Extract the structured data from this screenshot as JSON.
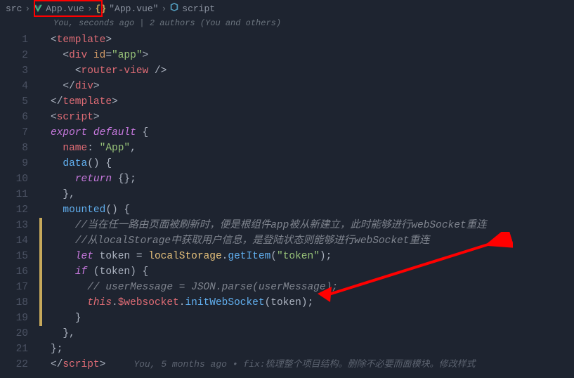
{
  "breadcrumb": {
    "src": "src",
    "file": "App.vue",
    "symbol_text": "\"App.vue\"",
    "script": "script"
  },
  "blame_top": "You, seconds ago | 2 authors (You and others)",
  "lines": {
    "n1": "1",
    "n2": "2",
    "n3": "3",
    "n4": "4",
    "n5": "5",
    "n6": "6",
    "n7": "7",
    "n8": "8",
    "n9": "9",
    "n10": "10",
    "n11": "11",
    "n12": "12",
    "n13": "13",
    "n14": "14",
    "n15": "15",
    "n16": "16",
    "n17": "17",
    "n18": "18",
    "n19": "19",
    "n20": "20",
    "n21": "21",
    "n22": "22"
  },
  "code": {
    "l1_open": "<",
    "l1_tag": "template",
    "l1_close": ">",
    "l2_open": "<",
    "l2_tag": "div",
    "l2_sp": " ",
    "l2_attr": "id",
    "l2_eq": "=",
    "l2_val": "\"app\"",
    "l2_close": ">",
    "l3_open": "<",
    "l3_tag": "router-view",
    "l3_close": " />",
    "l4_open": "</",
    "l4_tag": "div",
    "l4_close": ">",
    "l5_open": "</",
    "l5_tag": "template",
    "l5_close": ">",
    "l6_open": "<",
    "l6_tag": "script",
    "l6_close": ">",
    "l7_kw1": "export",
    "l7_kw2": "default",
    "l7_brace": " {",
    "l8_prop": "name",
    "l8_colon": ": ",
    "l8_val": "\"App\"",
    "l8_comma": ",",
    "l9_func": "data",
    "l9_paren": "()",
    "l9_brace": " {",
    "l10_kw": "return",
    "l10_rest": " {};",
    "l11_close": "},",
    "l12_func": "mounted",
    "l12_paren": "()",
    "l12_brace": " {",
    "l13_comment": "//当在任一路由页面被刷新时，便是根组件app被从新建立，此时能够进行webSocket重连",
    "l14_comment": "//从localStorage中获取用户信息，是登陆状态则能够进行webSocket重连",
    "l15_kw": "let",
    "l15_sp": " ",
    "l15_var": "token",
    "l15_eq": " = ",
    "l15_obj": "localStorage",
    "l15_dot": ".",
    "l15_method": "getItem",
    "l15_open": "(",
    "l15_arg": "\"token\"",
    "l15_close": ");",
    "l16_kw": "if",
    "l16_sp": " ",
    "l16_open": "(",
    "l16_var": "token",
    "l16_close": ")",
    "l16_brace": " {",
    "l17_comment": "// userMessage = JSON.parse(userMessage);",
    "l18_this": "this",
    "l18_dot1": ".",
    "l18_prop": "$websocket",
    "l18_dot2": ".",
    "l18_method": "initWebSocket",
    "l18_open": "(",
    "l18_arg": "token",
    "l18_close": ");",
    "l19_close": "}",
    "l20_close": "},",
    "l21_close": "};",
    "l22_open": "</",
    "l22_tag": "script",
    "l22_close": ">"
  },
  "blame_inline": "You, 5 months ago • fix:梳理整个项目结构。删除不必要而面模块。修改样式"
}
